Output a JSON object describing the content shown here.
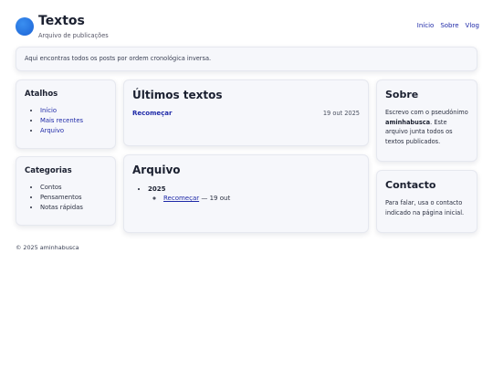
{
  "site": {
    "title": "Textos",
    "subtitle": "Arquivo de publicações",
    "logo_color": "#2a7be4"
  },
  "nav": {
    "items": [
      "Início",
      "Sobre",
      "Vlog"
    ]
  },
  "intro": {
    "text": "Aqui encontras todos os posts por ordem cronológica inversa."
  },
  "atalhos": {
    "title": "Atalhos",
    "items": [
      "Início",
      "Mais recentes",
      "Arquivo"
    ]
  },
  "categorias": {
    "title": "Categorias",
    "items": [
      "Contos",
      "Pensamentos",
      "Notas rápidas"
    ]
  },
  "ultimos": {
    "title": "Últimos textos",
    "posts": [
      {
        "title": "Recomeçar",
        "date": "19 out 2025"
      }
    ]
  },
  "arquivo": {
    "title": "Arquivo",
    "years": [
      {
        "year": "2025",
        "entries": [
          {
            "title": "Recomeçar",
            "suffix": " — 19 out"
          }
        ]
      }
    ]
  },
  "sobre": {
    "title": "Sobre",
    "text_before": "Escrevo com o pseudónimo ",
    "name": "aminhabusca",
    "text_after": ". Este arquivo junta todos os textos publicados."
  },
  "contacto": {
    "title": "Contacto",
    "text": "Para falar, usa o contacto indicado na página inicial."
  },
  "footer": {
    "text": "© 2025 aminhabusca"
  }
}
